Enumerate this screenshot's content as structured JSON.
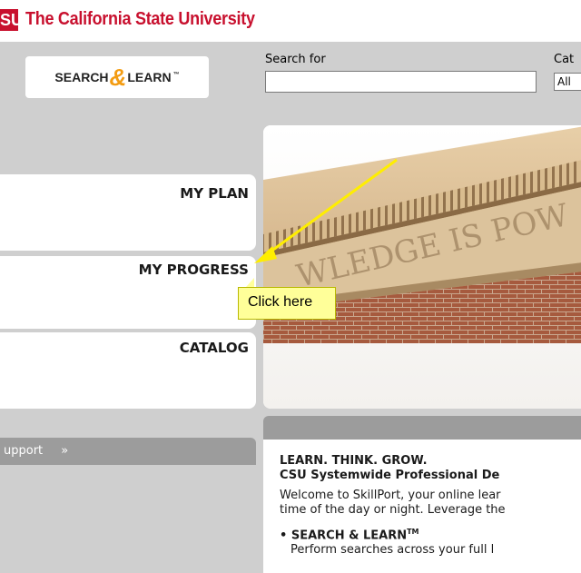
{
  "header": {
    "logo_text": "SU",
    "university": "The California State University"
  },
  "search": {
    "logo_left": "SEARCH",
    "logo_amp": "&",
    "logo_right": "LEARN",
    "logo_tm": "™",
    "label": "Search for",
    "value": "",
    "category_label": "Cat",
    "category_value": "All"
  },
  "nav": {
    "plan": "MY PLAN",
    "progress": "MY PROGRESS",
    "catalog": "CATALOG"
  },
  "banner": {
    "inscription": "WLEDGE IS POW"
  },
  "callout": {
    "text": "Click here"
  },
  "support": {
    "label": "upport",
    "chevron": "»"
  },
  "welcome": {
    "heading1": "LEARN. THINK. GROW.",
    "heading2": "CSU Systemwide Professional De",
    "text1": "Welcome to SkillPort, your online lear",
    "text2": "time of the day or night. Leverage the",
    "bullet_title": "SEARCH & LEARN",
    "bullet_tm": "TM",
    "bullet_text": "Perform searches across your full l"
  },
  "colors": {
    "brand_red": "#c8102e",
    "arrow_yellow": "#ffee00",
    "callout_bg": "#ffff99"
  }
}
